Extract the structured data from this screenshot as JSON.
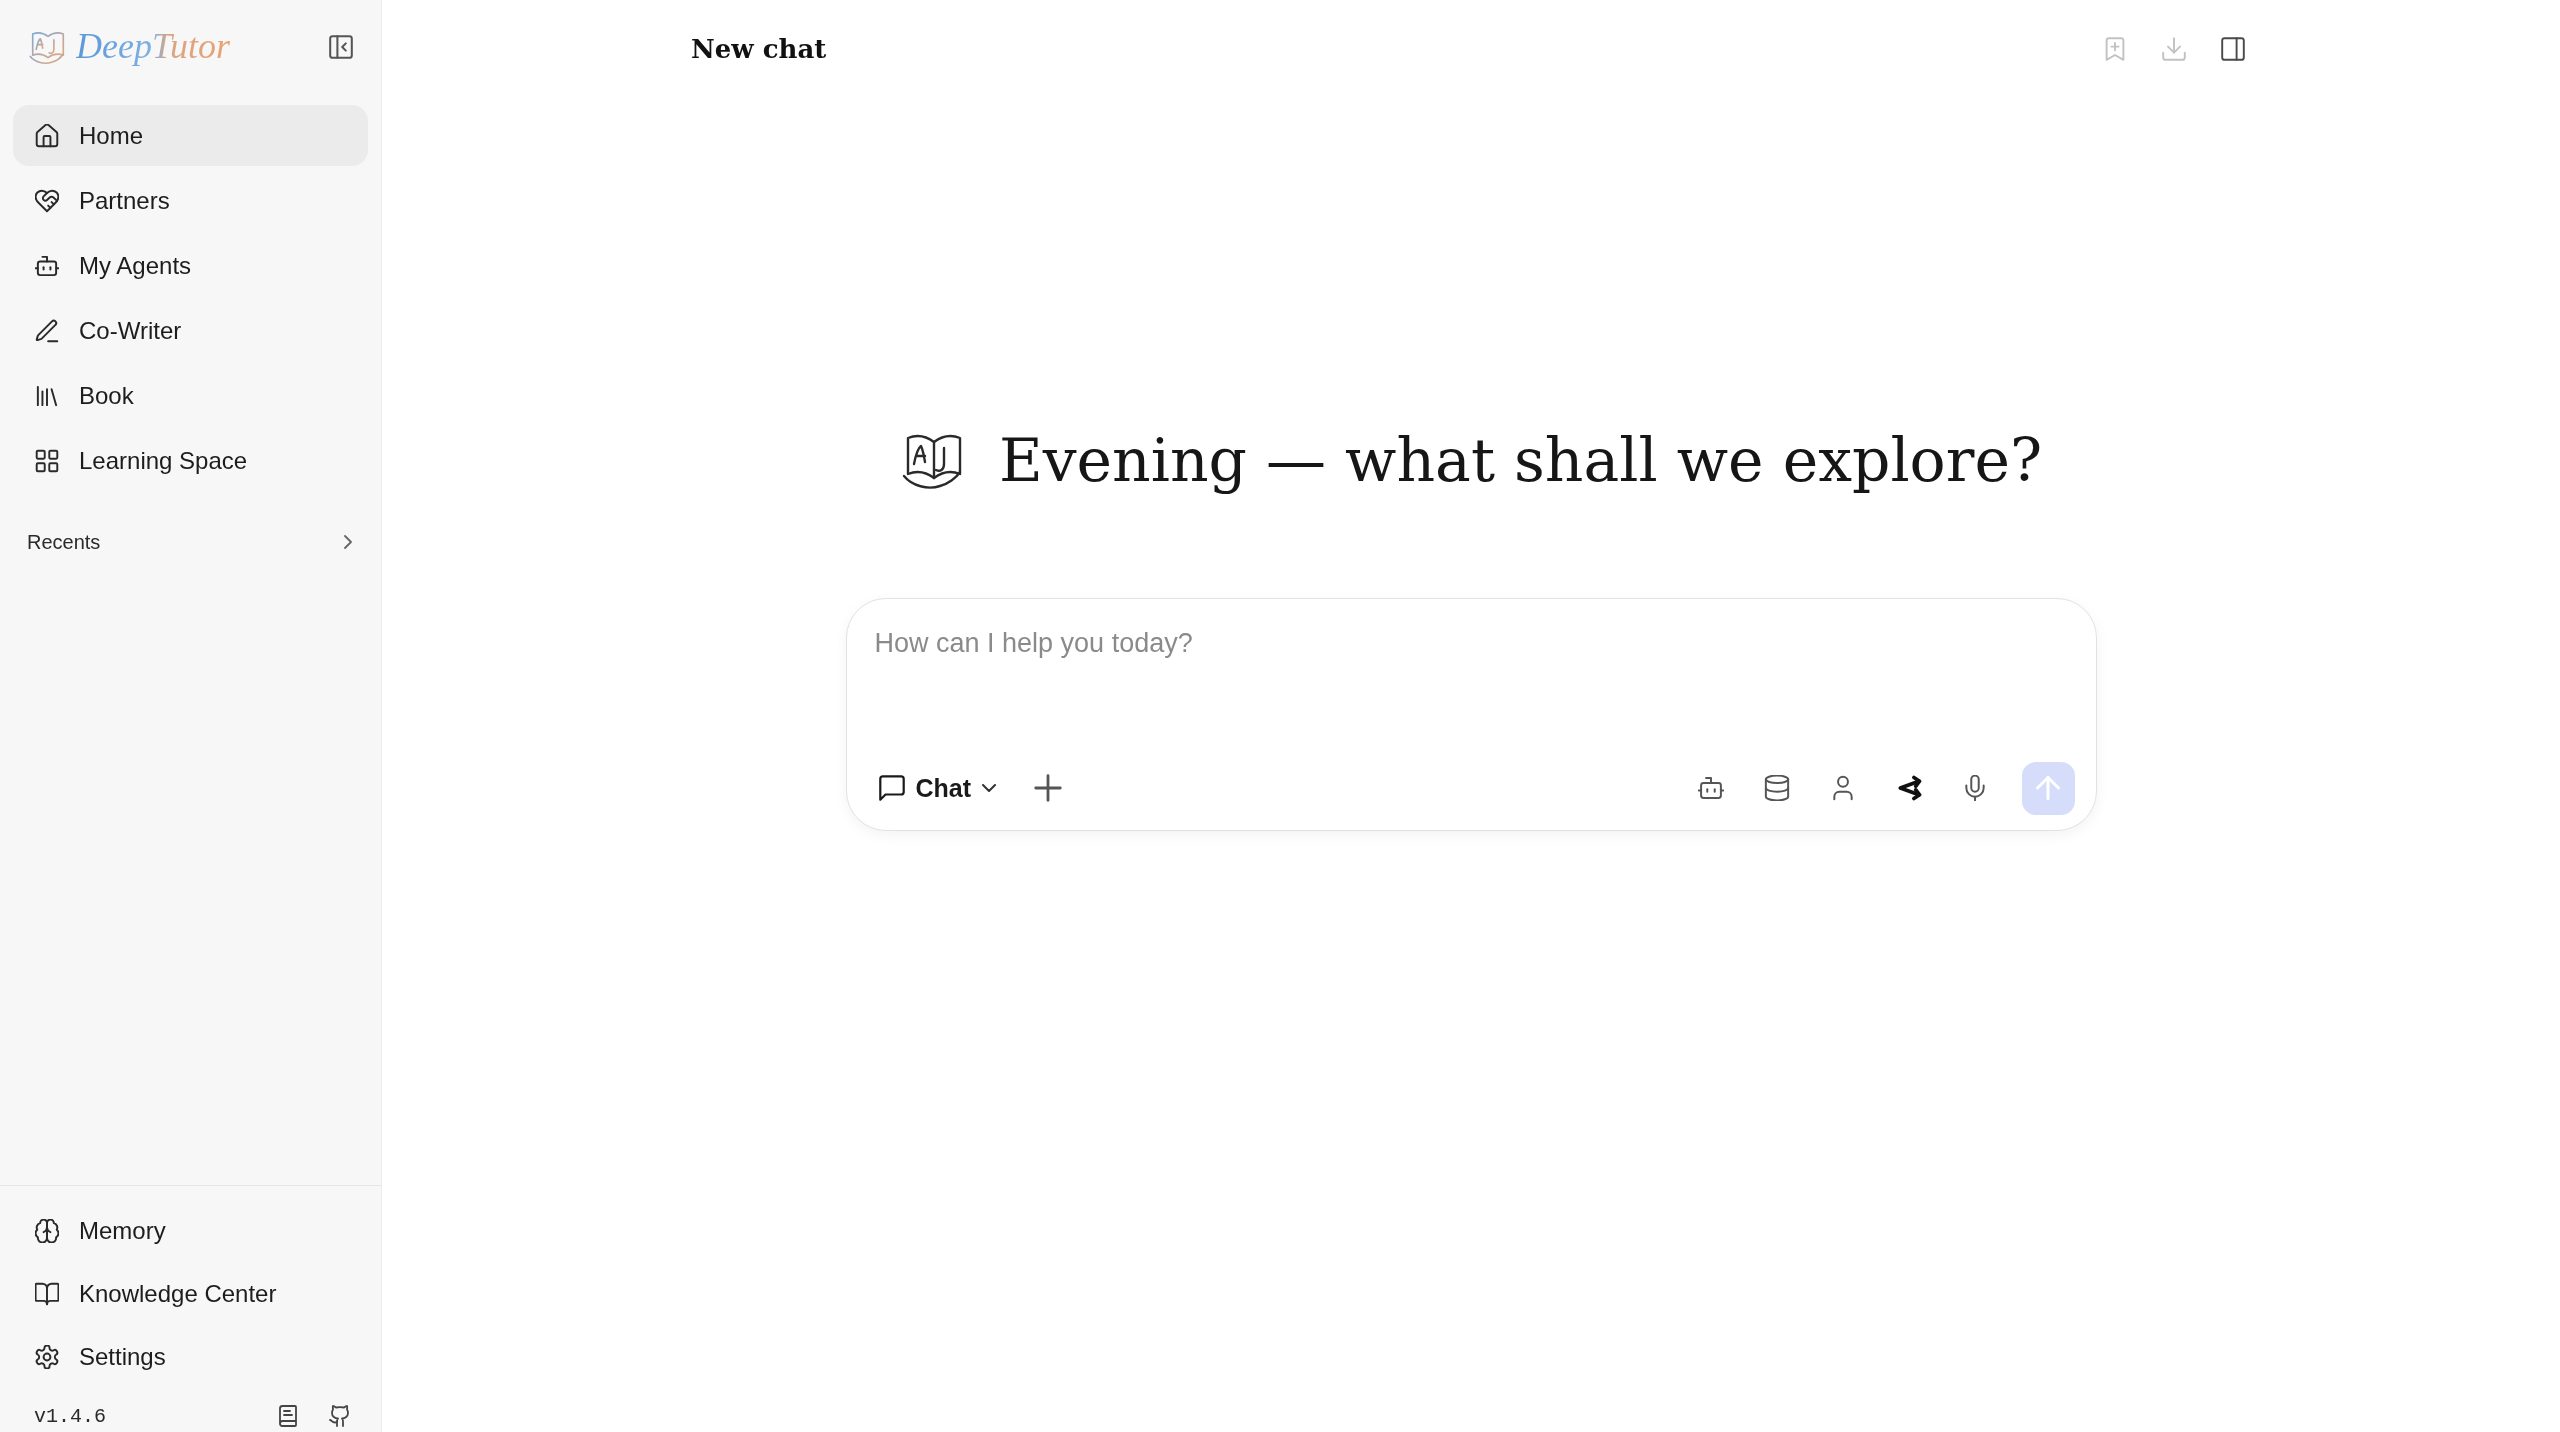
{
  "sidebar": {
    "logo_text": "DeepTutor",
    "nav_items": [
      {
        "label": "Home",
        "selected": true
      },
      {
        "label": "Partners",
        "selected": false
      },
      {
        "label": "My Agents",
        "selected": false
      },
      {
        "label": "Co-Writer",
        "selected": false
      },
      {
        "label": "Book",
        "selected": false
      },
      {
        "label": "Learning Space",
        "selected": false
      }
    ],
    "recents_label": "Recents",
    "bottom_items": [
      {
        "label": "Memory",
        "selected": false
      },
      {
        "label": "Knowledge Center",
        "selected": false
      },
      {
        "label": "Settings",
        "selected": false
      }
    ],
    "version": "v1.4.6"
  },
  "header": {
    "title": "New chat",
    "actions": [
      {
        "disabled": true
      },
      {
        "disabled": true
      },
      {
        "disabled": false
      }
    ]
  },
  "hero": {
    "heading": "Evening — what shall we explore?"
  },
  "composer": {
    "placeholder": "How can I help you today?",
    "mode": "Chat",
    "send_disabled": true
  }
}
